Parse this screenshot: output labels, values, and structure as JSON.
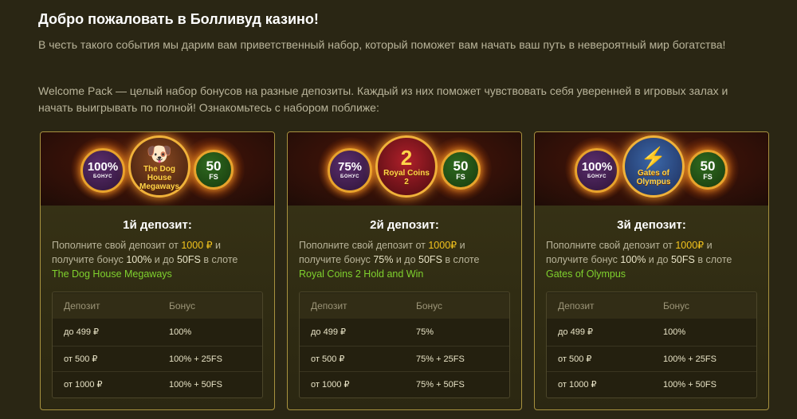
{
  "header": {
    "title": "Добро пожаловать в Болливуд казино!",
    "intro": "В честь такого события мы дарим вам приветственный набор, который поможет вам начать ваш путь в невероятный мир богатства!",
    "intro2": "Welcome Pack — целый набор бонусов на разные депозиты. Каждый из них поможет чувствовать себя уверенней в игровых залах и начать выигрывать по полной! Ознакомьтесь с набором поближе:"
  },
  "colors": {
    "background": "#2a2614",
    "card_border": "#a8923f",
    "gold": "#f2c31d",
    "green_link": "#7fd12e"
  },
  "cards": [
    {
      "banner": {
        "pct": "100%",
        "pct_label": "БОНУС",
        "fs": "50",
        "fs_label": "FS",
        "game_logo": "The Dog House Megaways",
        "game_icon": "dog-icon"
      },
      "title": "1й депозит:",
      "desc_before": "Пополните свой депозит от ",
      "amount": "1000 ₽",
      "desc_middle": " и получите бонус ",
      "bonus_pct": "100%",
      "desc_after": " и до ",
      "fs_text": "50FS",
      "desc_slot": " в слоте",
      "slot": "The Dog House Megaways",
      "table": {
        "headers": [
          "Депозит",
          "Бонус"
        ],
        "rows": [
          [
            "до 499 ₽",
            "100%"
          ],
          [
            "от 500 ₽",
            "100% + 25FS"
          ],
          [
            "от 1000 ₽",
            "100% + 50FS"
          ]
        ]
      }
    },
    {
      "banner": {
        "pct": "75%",
        "pct_label": "БОНУС",
        "fs": "50",
        "fs_label": "FS",
        "game_logo": "Royal Coins 2",
        "game_icon": "coin-icon"
      },
      "title": "2й депозит:",
      "desc_before": "Пополните свой депозит от ",
      "amount": "1000₽",
      "desc_middle": " и получите бонус ",
      "bonus_pct": "75%",
      "desc_after": " и до ",
      "fs_text": "50FS",
      "desc_slot": " в слоте",
      "slot": "Royal Coins 2 Hold and Win",
      "table": {
        "headers": [
          "Депозит",
          "Бонус"
        ],
        "rows": [
          [
            "до 499 ₽",
            "75%"
          ],
          [
            "от 500 ₽",
            "75% + 25FS"
          ],
          [
            "от 1000 ₽",
            "75% + 50FS"
          ]
        ]
      }
    },
    {
      "banner": {
        "pct": "100%",
        "pct_label": "БОНУС",
        "fs": "50",
        "fs_label": "FS",
        "game_logo": "Gates of Olympus",
        "game_icon": "zeus-icon"
      },
      "title": "3й депозит:",
      "desc_before": "Пополните свой депозит от ",
      "amount": "1000₽",
      "desc_middle": " и получите бонус ",
      "bonus_pct": "100%",
      "desc_after": " и до ",
      "fs_text": "50FS",
      "desc_slot": " в слоте",
      "slot": "Gates of Olympus",
      "table": {
        "headers": [
          "Депозит",
          "Бонус"
        ],
        "rows": [
          [
            "до 499 ₽",
            "100%"
          ],
          [
            "от 500 ₽",
            "100% + 25FS"
          ],
          [
            "от 1000 ₽",
            "100% + 50FS"
          ]
        ]
      }
    }
  ]
}
